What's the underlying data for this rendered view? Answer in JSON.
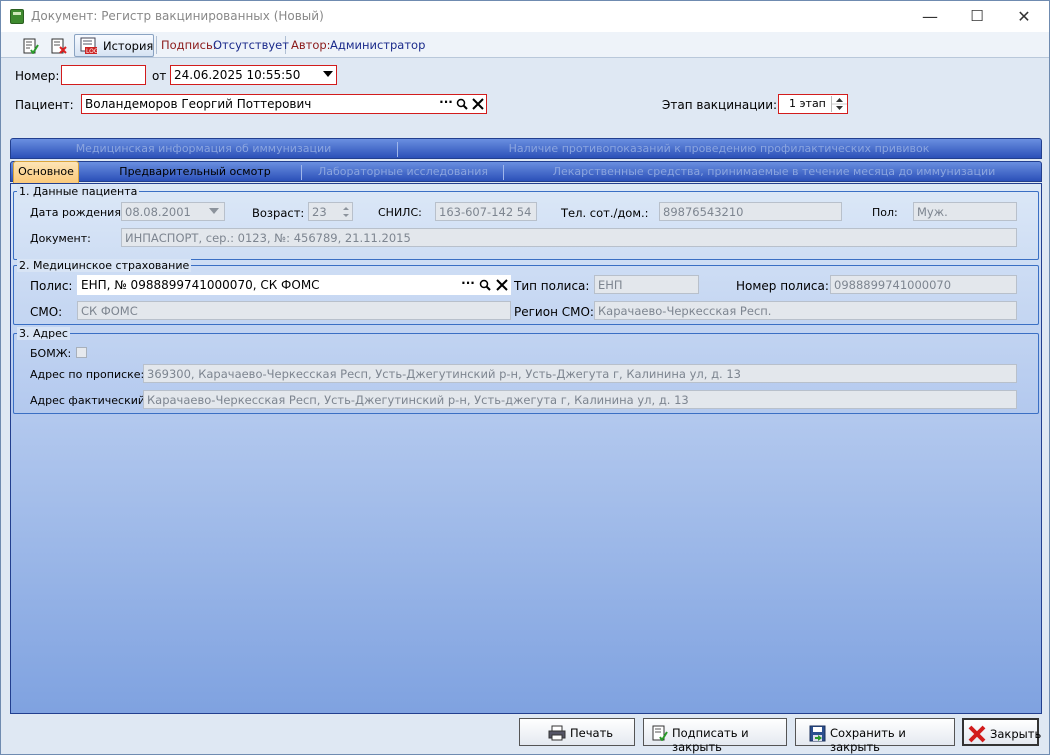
{
  "window": {
    "title": "Документ: Регистр вакцинированных (Новый)",
    "minimize_glyph": "—",
    "maximize_glyph": "☐",
    "close_glyph": "✕"
  },
  "toolbar": {
    "history_label": "История",
    "signature_label": "Подпись:",
    "signature_value": "Отсутствует",
    "author_label": "Автор:",
    "author_value": "Администратор"
  },
  "header": {
    "number_label": "Номер:",
    "number_value": "",
    "date_label": "от",
    "date_value": "24.06.2025 10:55:50",
    "patient_label": "Пациент:",
    "patient_value": "Воландеморов Георгий Поттерович",
    "stage_label": "Этап вакцинации:",
    "stage_value": "1 этап"
  },
  "tabs": {
    "row1": [
      "Медицинская информация об иммунизации",
      "Наличие противопоказаний к проведению профилактических прививок"
    ],
    "row2": [
      "Основное",
      "Предварительный осмотр",
      "Лабораторные исследования",
      "Лекарственные средства, принимаемые в течение месяца до иммунизации"
    ]
  },
  "patient_data": {
    "title": "1. Данные пациента",
    "birth_label": "Дата рождения:",
    "birth_value": "08.08.2001",
    "age_label": "Возраст:",
    "age_value": "23",
    "snils_label": "СНИЛС:",
    "snils_value": "163-607-142 54",
    "phone_label": "Тел. сот./дом.:",
    "phone_value": "89876543210",
    "sex_label": "Пол:",
    "sex_value": "Муж.",
    "doc_label": "Документ:",
    "doc_value": "ИНПАСПОРТ, сер.: 0123, №: 456789, 21.11.2015"
  },
  "insurance": {
    "title": "2. Медицинское страхование",
    "policy_label": "Полис:",
    "policy_value": "ЕНП, № 0988899741000070, СК ФОМС",
    "policy_type_label": "Тип полиса:",
    "policy_type_value": "ЕНП",
    "policy_number_label": "Номер полиса:",
    "policy_number_value": "0988899741000070",
    "smo_label": "СМО:",
    "smo_value": "СК ФОМС",
    "smo_region_label": "Регион СМО:",
    "smo_region_value": "Карачаево-Черкесская Респ."
  },
  "address": {
    "title": "3. Адрес",
    "homeless_label": "БОМЖ:",
    "reg_label": "Адрес по прописке:",
    "reg_value": "369300, Карачаево-Черкесская Респ, Усть-Джегутинский р-н, Усть-Джегута г, Калинина ул, д. 13",
    "fact_label": "Адрес фактический:",
    "fact_value": "Карачаево-Черкесская Респ, Усть-Джегутинский р-н, Усть-джегута г, Калинина ул, д. 13"
  },
  "footer": {
    "print_label": "Печать",
    "sign_close_label": "Подписать и закрыть",
    "save_close_label": "Сохранить и закрыть",
    "close_label": "Закрыть"
  }
}
